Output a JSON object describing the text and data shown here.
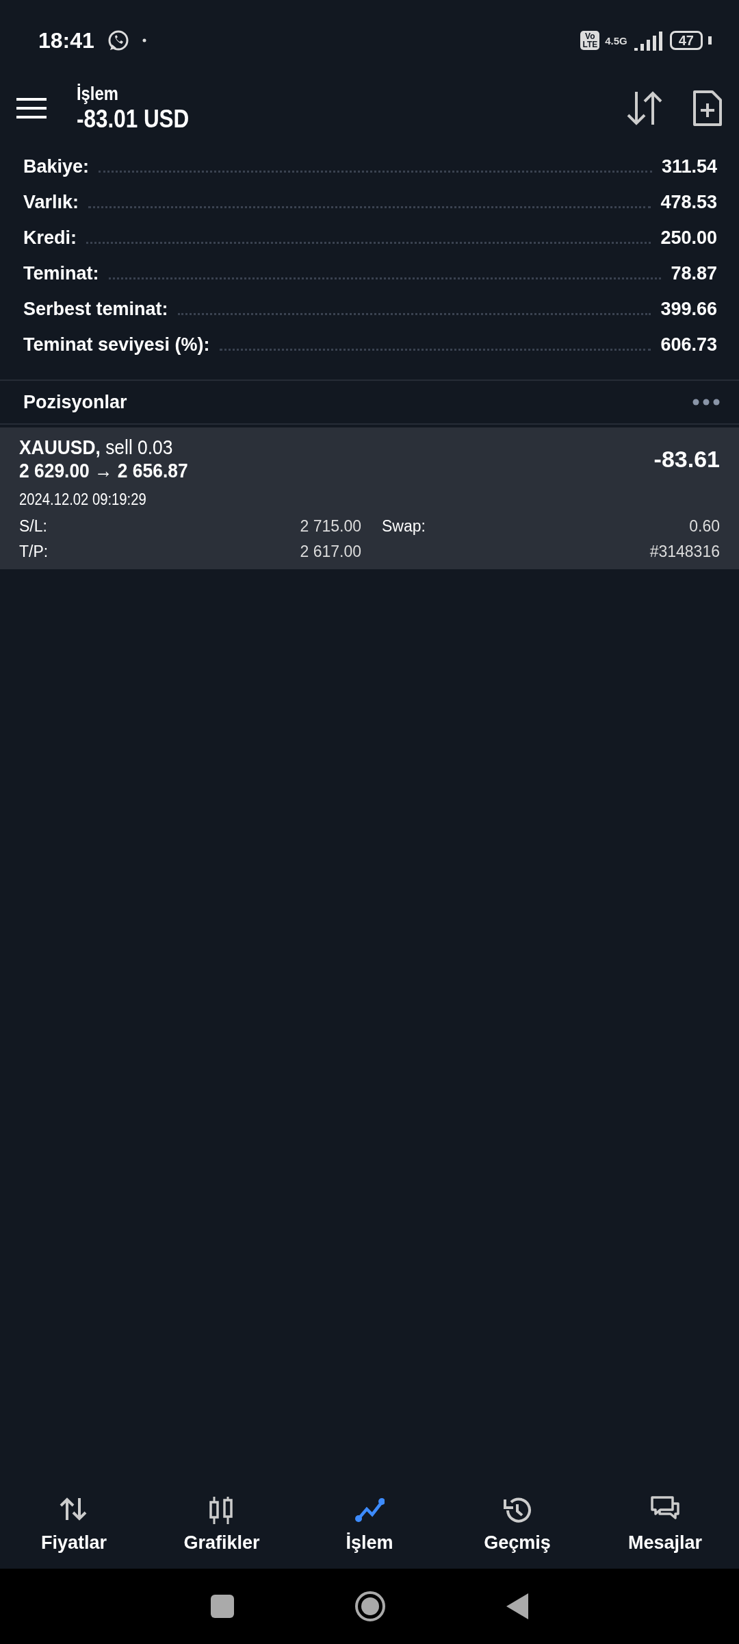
{
  "status_bar": {
    "time": "18:41",
    "volte_top": "Vo",
    "volte_bottom": "LTE",
    "network": "4.5G",
    "battery": "47"
  },
  "header": {
    "title": "İşlem",
    "value": "-83.01 USD"
  },
  "summary": [
    {
      "label": "Bakiye:",
      "value": "311.54"
    },
    {
      "label": "Varlık:",
      "value": "478.53"
    },
    {
      "label": "Kredi:",
      "value": "250.00"
    },
    {
      "label": "Teminat:",
      "value": "78.87"
    },
    {
      "label": "Serbest teminat:",
      "value": "399.66"
    },
    {
      "label": "Teminat seviyesi (%):",
      "value": "606.73"
    }
  ],
  "positions": {
    "title": "Pozisyonlar",
    "items": [
      {
        "symbol": "XAUUSD,",
        "side": "sell 0.03",
        "open_price": "2 629.00",
        "arrow": "→",
        "current_price": "2 656.87",
        "profit": "-83.61",
        "time": "2024.12.02 09:19:29",
        "sl_label": "S/L:",
        "sl": "2 715.00",
        "swap_label": "Swap:",
        "swap": "0.60",
        "tp_label": "T/P:",
        "tp": "2 617.00",
        "ticket": "#3148316"
      }
    ]
  },
  "nav": [
    {
      "kind": "quotes",
      "label": "Fiyatlar",
      "selected": false
    },
    {
      "kind": "charts",
      "label": "Grafikler",
      "selected": false
    },
    {
      "kind": "trade",
      "label": "İşlem",
      "selected": true
    },
    {
      "kind": "history",
      "label": "Geçmiş",
      "selected": false
    },
    {
      "kind": "messages",
      "label": "Mesajlar",
      "selected": false
    }
  ]
}
